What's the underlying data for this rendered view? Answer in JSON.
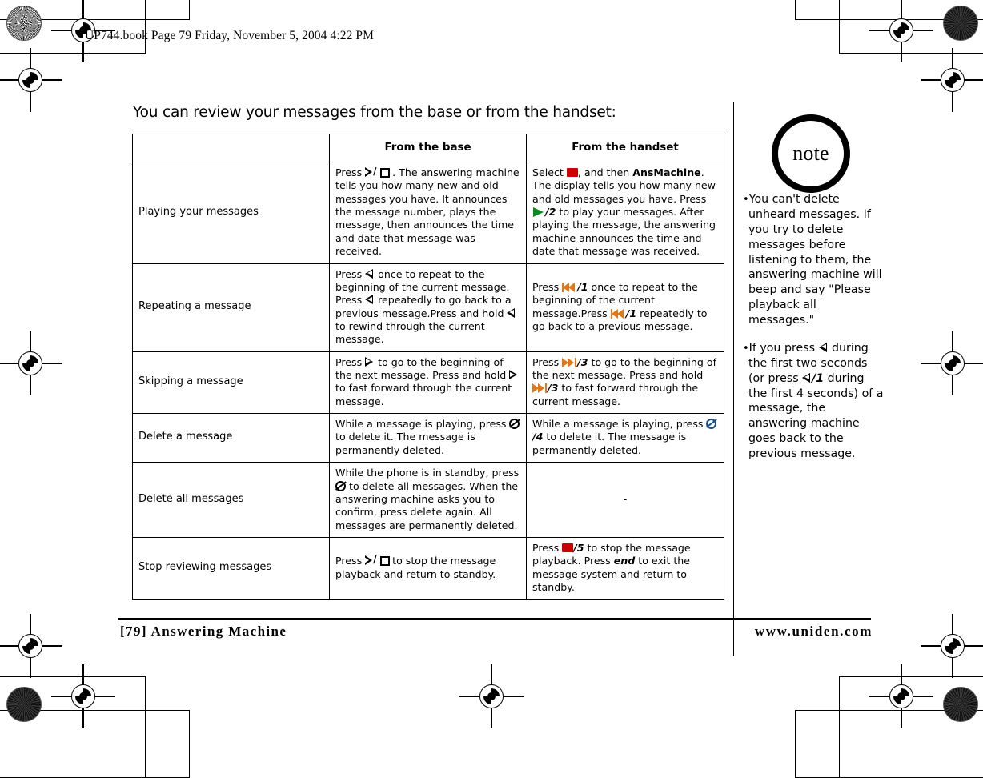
{
  "header": {
    "book_line": "UP744.book  Page 79  Friday, November 5, 2004  4:22 PM"
  },
  "intro": "You can review your messages from the base or from the handset:",
  "table": {
    "headers": [
      "",
      "From the base",
      "From the handset"
    ],
    "rows": [
      {
        "label": "Playing your messages",
        "base_parts": [
          {
            "t": "text",
            "v": "Press "
          },
          {
            "t": "icon",
            "v": "play-stop-icon"
          },
          {
            "t": "text",
            "v": " . The answering machine tells you how many new and old messages you have. It announces the message number, plays the message, then announces the time and date that message was received."
          }
        ],
        "base_text": "Press  . The answering machine tells you how many new and old messages you have. It announces the message number, plays the message, then announces the time and date that message was received.",
        "handset_text": "Select  , and then AnsMachine. The display tells you how many new and old messages you have. Press /2 to play your messages. After playing the message, the answering machine announces the time and date that message was received.",
        "handset_fragments": {
          "f1": "Select ",
          "f2": ", and then ",
          "f3": "AnsMachine",
          "f4": ". The display tells you how many new and old messages you have. Press ",
          "f5": "/2",
          "f6": " to play your messages. After playing the message, the answering machine announces the time and date that message was received."
        },
        "base_fragments": {
          "f1": "Press ",
          "f2": " . The answering machine tells you how many new and old messages you have. It announces the message number, plays the message, then announces the time and date that message was received."
        }
      },
      {
        "label": "Repeating a message",
        "base_fragments": {
          "f1": "Press ",
          "f2": " once to repeat to the beginning of the current message. Press ",
          "f3": " repeatedly to go back to a previous message.Press and hold ",
          "f4": " to rewind through the current message."
        },
        "handset_fragments": {
          "f1": "Press ",
          "f2": "/1",
          "f3": " once to repeat to the beginning of the current message.Press ",
          "f4": "/1",
          "f5": " repeatedly to go back to a previous message."
        }
      },
      {
        "label": "Skipping a message",
        "base_fragments": {
          "f1": "Press ",
          "f2": " to go to the beginning of the next message. Press and hold ",
          "f3": " to fast forward through the current message."
        },
        "handset_fragments": {
          "f1": "Press ",
          "f2": "/3",
          "f3": " to go to the beginning of the next message. Press and hold ",
          "f4": "/3",
          "f5": " to fast forward through the current message."
        }
      },
      {
        "label": "Delete a message",
        "base_fragments": {
          "f1": "While a message is playing, press ",
          "f2": " to delete it. The message is permanently deleted."
        },
        "handset_fragments": {
          "f1": "While a message is playing, press ",
          "f2": "/4",
          "f3": " to delete it. The message is permanently deleted."
        }
      },
      {
        "label": "Delete all messages",
        "base_fragments": {
          "f1": "While the phone is in standby, press ",
          "f2": " to delete all messages. When the answering machine asks you to confirm, press delete again. All messages are permanently deleted."
        },
        "handset_dash": "-"
      },
      {
        "label": "Stop reviewing messages",
        "base_fragments": {
          "f1": "Press ",
          "f2": " to stop the message playback and return to standby."
        },
        "handset_fragments": {
          "f1": "Press ",
          "f2": "/5",
          "f3": " to stop the message playback. Press ",
          "f4": "end",
          "f5": " to exit the message system and return to standby."
        }
      }
    ]
  },
  "note": {
    "badge_label": "note",
    "bullet_char": "•",
    "items": [
      {
        "f1": "You can't delete unheard messages. If you try to delete messages before listening to them, the answering machine will beep and say \"Please playback all messages.\""
      },
      {
        "f1": "If you press ",
        "f2": " during the first two seconds (or press ",
        "f3": "/1",
        "f4": " during the first 4 seconds) of a message, the answering machine goes back to the previous message."
      }
    ]
  },
  "footer": {
    "left": "[79] Answering Machine",
    "right": "www.uniden.com"
  },
  "colors": {
    "end_key_red": "#cc0000",
    "play_green": "#0a8a20",
    "skip_orange": "#e07818",
    "delete_blue": "#1c4e8a",
    "ink": "#000000"
  }
}
